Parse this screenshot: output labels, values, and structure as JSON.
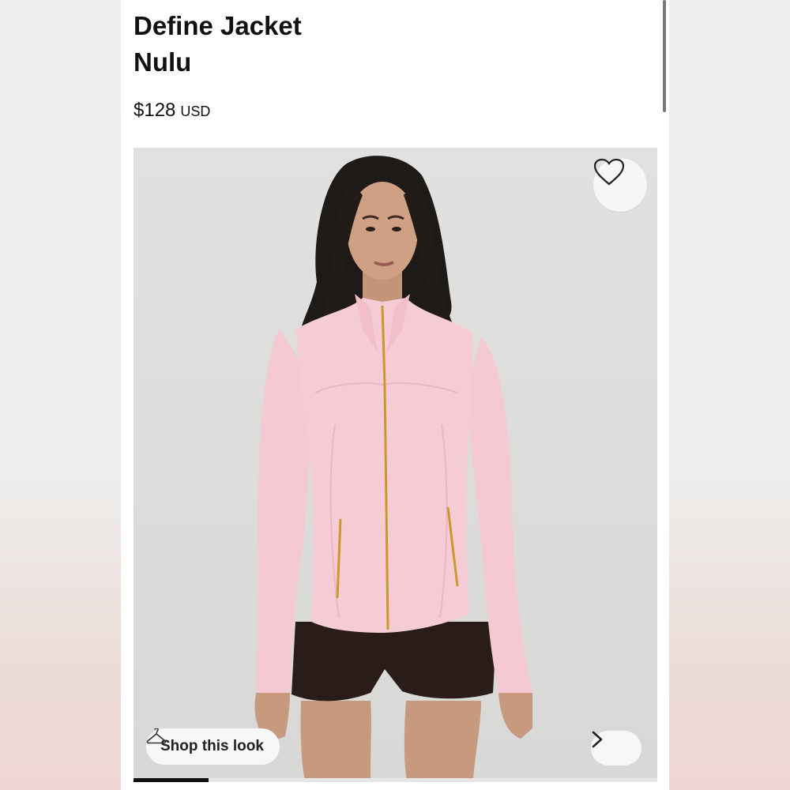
{
  "product": {
    "title_line1": "Define Jacket",
    "title_line2": "Nulu",
    "price": "$128",
    "currency": "USD"
  },
  "gallery": {
    "favorite_icon": "heart-outline-icon",
    "shop_look": {
      "icon": "hanger-icon",
      "label": "Shop this look"
    },
    "next_icon": "chevron-right-icon",
    "progress": 0.143,
    "jacket_color": "#f4c9d1",
    "zipper_color": "#c89a2c"
  }
}
